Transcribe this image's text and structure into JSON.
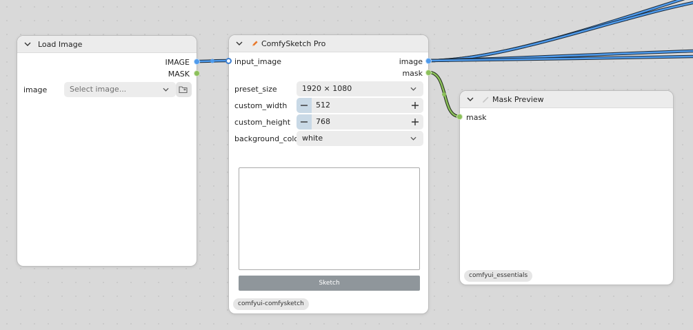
{
  "colors": {
    "image_wire": "#4f9bec",
    "mask_wire": "#8cc05b",
    "edit_icon": "#e8772a"
  },
  "load_image": {
    "title": "Load Image",
    "outputs": [
      "IMAGE",
      "MASK"
    ],
    "widget_label": "image",
    "widget_placeholder": "Select image..."
  },
  "sketch": {
    "title": "ComfySketch Pro",
    "icon": "pencil-icon",
    "input": "input_image",
    "outputs": [
      "image",
      "mask"
    ],
    "preset_size": {
      "label": "preset_size",
      "value": "1920 × 1080"
    },
    "custom_width": {
      "label": "custom_width",
      "value": "512"
    },
    "custom_height": {
      "label": "custom_height",
      "value": "768"
    },
    "background_color": {
      "label": "background_color",
      "value": "white"
    },
    "button": "Sketch",
    "badge": "comfyui-comfysketch"
  },
  "mask_preview": {
    "title": "Mask Preview",
    "input": "mask",
    "badge": "comfyui_essentials"
  }
}
